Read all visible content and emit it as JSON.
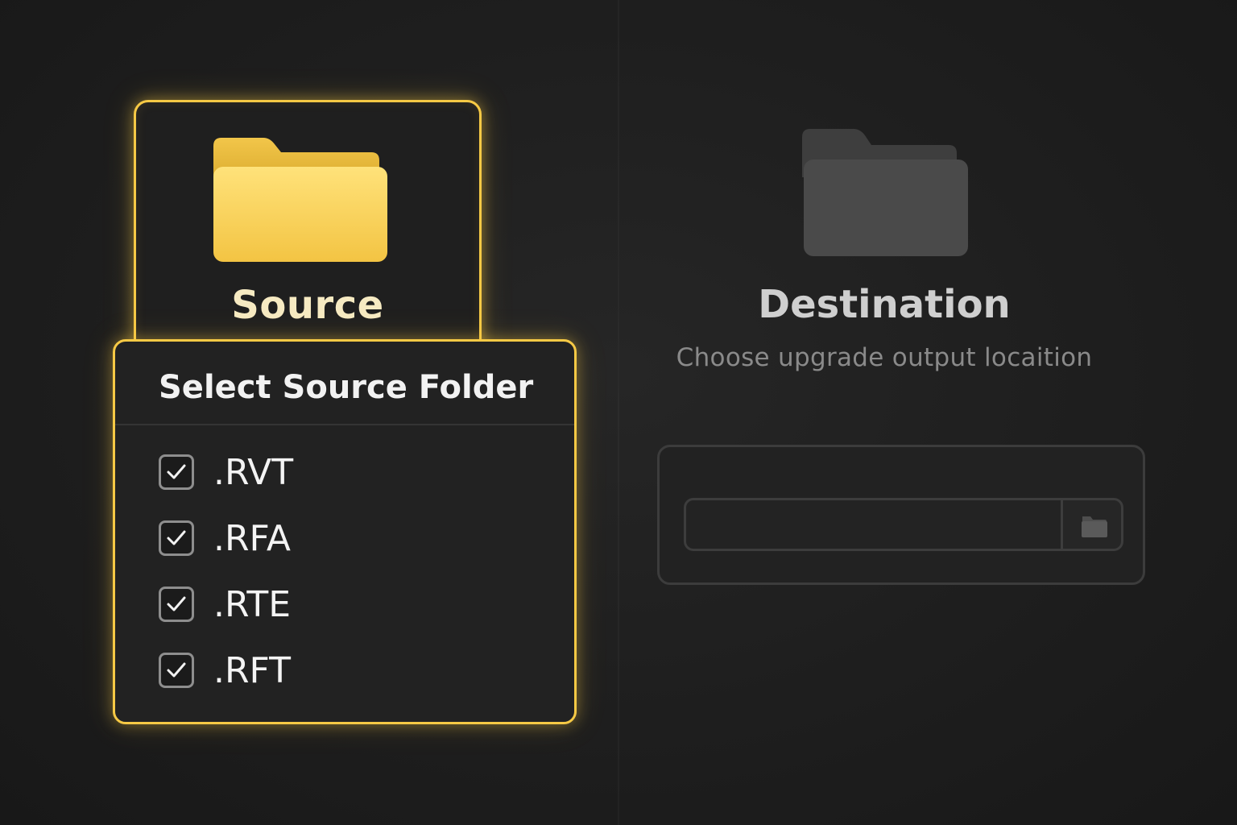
{
  "colors": {
    "accent": "#f6c945",
    "background": "#1e1e1e",
    "dest_folder": "#4a4a4a"
  },
  "source": {
    "title": "Source",
    "icon": "folder-icon"
  },
  "dropdown": {
    "title": "Select Source Folder",
    "options": [
      {
        "label": ".RVT",
        "checked": true
      },
      {
        "label": ".RFA",
        "checked": true
      },
      {
        "label": ".RTE",
        "checked": true
      },
      {
        "label": ".RFT",
        "checked": true
      }
    ]
  },
  "destination": {
    "title": "Destination",
    "subtitle": "Choose upgrade output locaition",
    "icon": "folder-icon",
    "path_value": "",
    "browse_icon": "folder-icon"
  }
}
